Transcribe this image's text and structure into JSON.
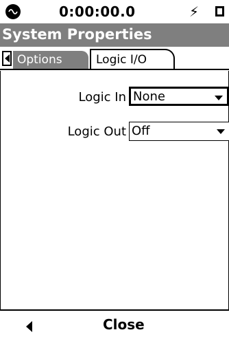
{
  "status": {
    "clock": "0:00:00.0",
    "app_icon": "meter-logo-icon",
    "power_icon": "lightning-bolt-icon",
    "battery_icon": "battery-icon"
  },
  "title": "System Properties",
  "tabs": [
    {
      "label": "Options",
      "selected": false
    },
    {
      "label": "Logic I/O",
      "selected": true
    }
  ],
  "form": {
    "logic_in": {
      "label": "Logic In",
      "value": "None"
    },
    "logic_out": {
      "label": "Logic Out",
      "value": "Off"
    }
  },
  "footer": {
    "back_icon": "left-arrow-icon",
    "close_label": "Close"
  },
  "colors": {
    "title_bg": "#7f7f7f",
    "inactive_tab_bg": "#7f7f7f"
  }
}
